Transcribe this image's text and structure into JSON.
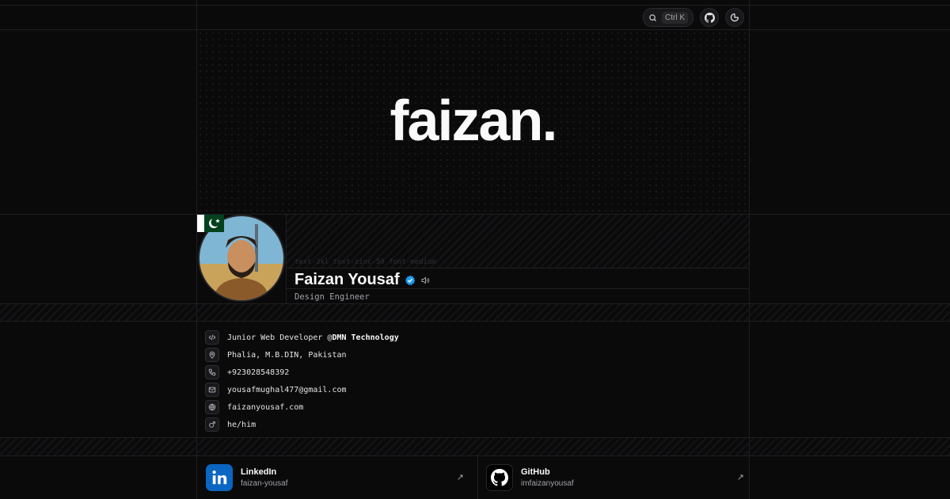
{
  "topbar": {
    "search_shortcut": "Ctrl K"
  },
  "brand": {
    "logo_text": "faizan."
  },
  "profile": {
    "class_hint": "text-3xl text-zinc-50 font-medium",
    "name": "Faizan Yousaf",
    "role": "Design Engineer",
    "verified_color": "#1d9bf0"
  },
  "info": {
    "job_prefix": "Junior Web Developer @",
    "job_company": "DMN Technology",
    "location": "Phalia, M.B.DIN, Pakistan",
    "phone": "+923028548392",
    "email": "yousafmughal477@gmail.com",
    "website": "faizanyousaf.com",
    "pronouns": "he/him"
  },
  "socials": [
    {
      "title": "LinkedIn",
      "handle": "faizan-yousaf",
      "icon": "linkedin-icon",
      "color": "#0a66c2"
    },
    {
      "title": "GitHub",
      "handle": "imfaizanyousaf",
      "icon": "github-icon",
      "color": "#ffffff"
    }
  ],
  "icons": [
    "search-icon",
    "github-icon",
    "theme-toggle-icon",
    "code-icon",
    "map-pin-icon",
    "phone-icon",
    "mail-icon",
    "globe-icon",
    "gender-icon",
    "verified-icon",
    "speaker-icon",
    "arrow-up-right-icon"
  ]
}
